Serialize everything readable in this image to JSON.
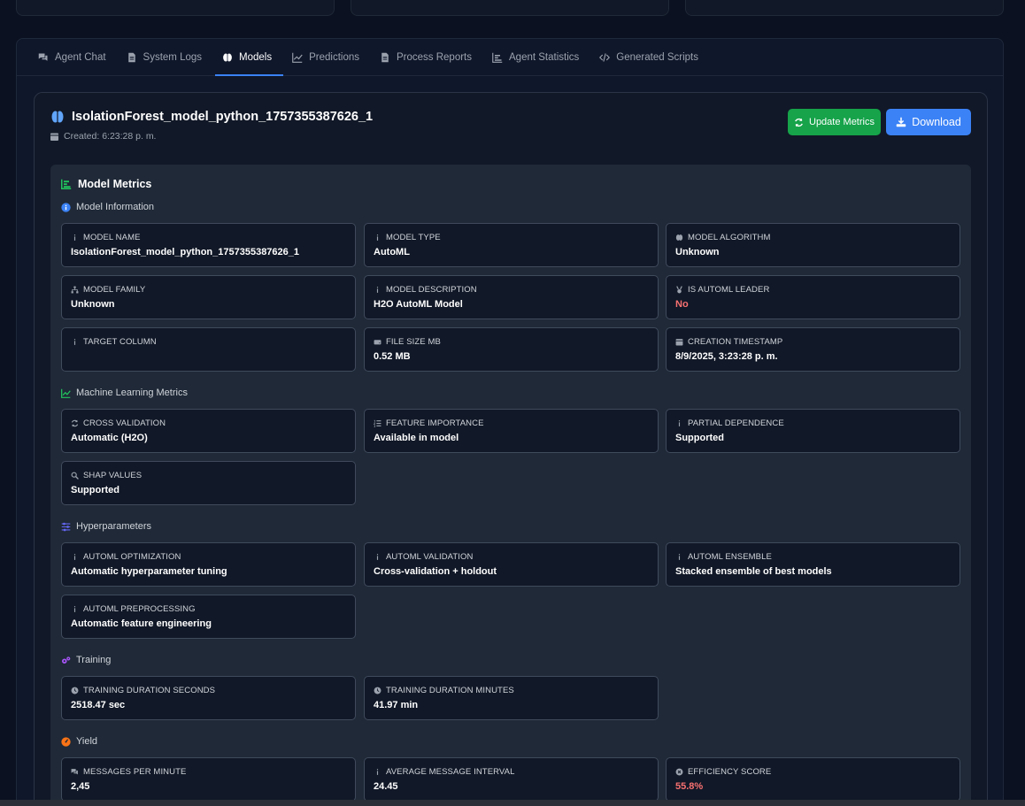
{
  "tabs": [
    {
      "label": "Agent Chat",
      "icon": "comments-icon"
    },
    {
      "label": "System Logs",
      "icon": "file-icon"
    },
    {
      "label": "Models",
      "icon": "brain-icon"
    },
    {
      "label": "Predictions",
      "icon": "line-chart-icon"
    },
    {
      "label": "Process Reports",
      "icon": "file-lines-icon"
    },
    {
      "label": "Agent Statistics",
      "icon": "bar-chart-icon"
    },
    {
      "label": "Generated Scripts",
      "icon": "code-icon"
    }
  ],
  "active_tab": "Models",
  "model": {
    "title": "IsolationForest_model_python_1757355387626_1",
    "created": "Created: 6:23:28 p. m.",
    "update_label": "Update Metrics",
    "download_label": "Download"
  },
  "metrics": {
    "title": "Model Metrics",
    "sections": [
      {
        "title": "Model Information",
        "icon": "info-circle-icon",
        "items": [
          {
            "label": "MODEL NAME",
            "value": "IsolationForest_model_python_1757355387626_1",
            "icon": "info-icon"
          },
          {
            "label": "MODEL TYPE",
            "value": "AutoML",
            "icon": "info-icon"
          },
          {
            "label": "MODEL ALGORITHM",
            "value": "Unknown",
            "icon": "brain-icon"
          },
          {
            "label": "MODEL FAMILY",
            "value": "Unknown",
            "icon": "sitemap-icon"
          },
          {
            "label": "MODEL DESCRIPTION",
            "value": "H2O AutoML Model",
            "icon": "info-icon"
          },
          {
            "label": "IS AUTOML LEADER",
            "value": "No",
            "icon": "medal-icon",
            "value_color": "#f87171"
          },
          {
            "label": "TARGET COLUMN",
            "value": "",
            "icon": "info-icon"
          },
          {
            "label": "FILE SIZE MB",
            "value": "0.52 MB",
            "icon": "hdd-icon"
          },
          {
            "label": "CREATION TIMESTAMP",
            "value": "8/9/2025, 3:23:28 p. m.",
            "icon": "calendar-icon"
          }
        ]
      },
      {
        "title": "Machine Learning Metrics",
        "icon": "line-chart-icon",
        "items": [
          {
            "label": "CROSS VALIDATION",
            "value": "Automatic (H2O)",
            "icon": "sync-icon"
          },
          {
            "label": "FEATURE IMPORTANCE",
            "value": "Available in model",
            "icon": "list-ol-icon"
          },
          {
            "label": "PARTIAL DEPENDENCE",
            "value": "Supported",
            "icon": "info-icon"
          },
          {
            "label": "SHAP VALUES",
            "value": "Supported",
            "icon": "search-icon"
          }
        ]
      },
      {
        "title": "Hyperparameters",
        "icon": "sliders-icon",
        "items": [
          {
            "label": "AUTOML OPTIMIZATION",
            "value": "Automatic hyperparameter tuning",
            "icon": "info-icon"
          },
          {
            "label": "AUTOML VALIDATION",
            "value": "Cross-validation + holdout",
            "icon": "info-icon"
          },
          {
            "label": "AUTOML ENSEMBLE",
            "value": "Stacked ensemble of best models",
            "icon": "info-icon"
          },
          {
            "label": "AUTOML PREPROCESSING",
            "value": "Automatic feature engineering",
            "icon": "info-icon"
          }
        ]
      },
      {
        "title": "Training",
        "icon": "cogs-icon",
        "items": [
          {
            "label": "TRAINING DURATION SECONDS",
            "value": "2518.47 sec",
            "icon": "clock-icon"
          },
          {
            "label": "TRAINING DURATION MINUTES",
            "value": "41.97 min",
            "icon": "clock-icon"
          }
        ]
      },
      {
        "title": "Yield",
        "icon": "gauge-icon",
        "items": [
          {
            "label": "MESSAGES PER MINUTE",
            "value": "2,45",
            "icon": "comments-icon"
          },
          {
            "label": "AVERAGE MESSAGE INTERVAL",
            "value": "24.45",
            "icon": "info-icon"
          },
          {
            "label": "EFFICIENCY SCORE",
            "value": "55.8%",
            "icon": "x-circle-icon",
            "value_color": "#f87171"
          }
        ]
      }
    ]
  },
  "colors": {
    "accent": "#3b82f6",
    "success": "#16a34a",
    "danger": "#f87171"
  }
}
